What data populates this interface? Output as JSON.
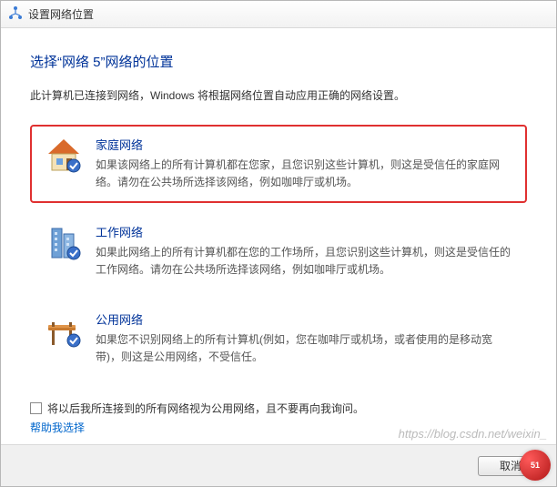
{
  "window": {
    "title": "设置网络位置"
  },
  "heading": "选择“网络 5”网络的位置",
  "subtext": "此计算机已连接到网络，Windows 将根据网络位置自动应用正确的网络设置。",
  "options": {
    "home": {
      "title": "家庭网络",
      "desc": "如果该网络上的所有计算机都在您家，且您识别这些计算机，则这是受信任的家庭网络。请勿在公共场所选择该网络，例如咖啡厅或机场。"
    },
    "work": {
      "title": "工作网络",
      "desc": "如果此网络上的所有计算机都在您的工作场所，且您识别这些计算机，则这是受信任的工作网络。请勿在公共场所选择该网络，例如咖啡厅或机场。"
    },
    "public": {
      "title": "公用网络",
      "desc": "如果您不识别网络上的所有计算机(例如，您在咖啡厅或机场，或者使用的是移动宽带)，则这是公用网络，不受信任。"
    }
  },
  "checkbox_label": "将以后我所连接到的所有网络视为公用网络，且不要再向我询问。",
  "help_link": "帮助我选择",
  "footer": {
    "cancel": "取消"
  },
  "watermark": "https://blog.csdn.net/weixin_"
}
